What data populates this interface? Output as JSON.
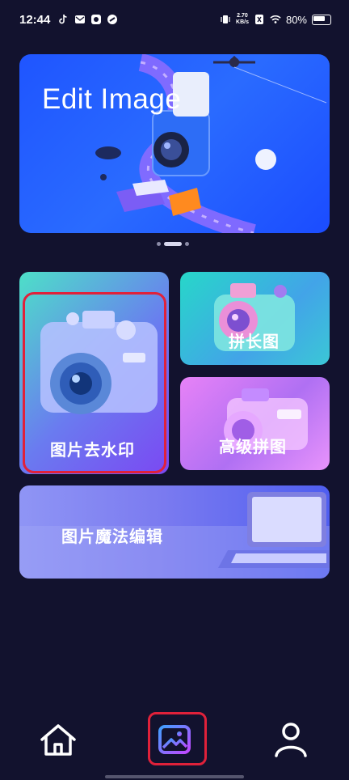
{
  "status_bar": {
    "time": "12:44",
    "net_speed_value": "2.70",
    "net_speed_unit": "KB/s",
    "battery": "80%"
  },
  "banner": {
    "title": "Edit Image",
    "page_count": 3,
    "active_page": 2
  },
  "cards": {
    "watermark": "图片去水印",
    "long_image": "拼长图",
    "advanced": "高级拼图",
    "magic": "图片魔法编辑"
  },
  "nav": {
    "home_icon": "home-icon",
    "image_icon": "image-icon",
    "profile_icon": "user-icon",
    "selected": "image"
  },
  "colors": {
    "background": "#12122e",
    "highlight": "#e0213a",
    "banner": "#1f55ff"
  }
}
